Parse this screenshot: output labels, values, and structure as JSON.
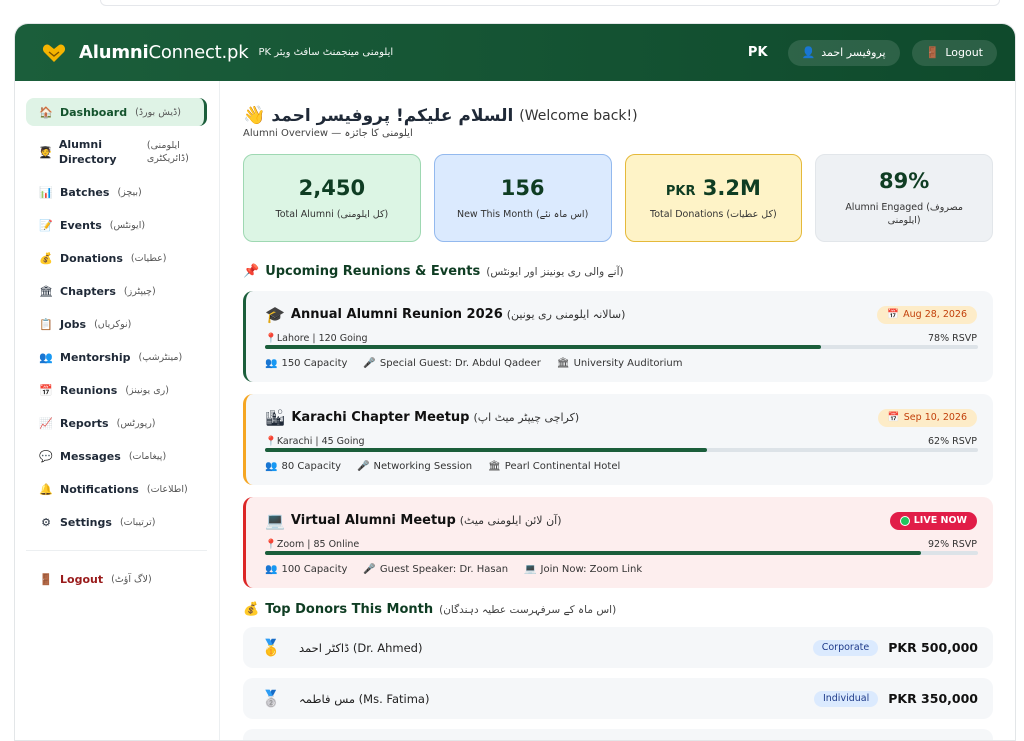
{
  "header": {
    "brand_bold": "Alumni",
    "brand_light": "Connect.pk",
    "subtitle": "PK ایلومنی مینجمنٹ سافٹ ویئر",
    "country": "PK",
    "user_label": "پروفیسر احمد",
    "logout_label": "Logout"
  },
  "sidebar": {
    "items": [
      {
        "label": "Dashboard",
        "urdu": "(ڈیش بورڈ)",
        "icon": "🏠"
      },
      {
        "label": "Alumni Directory",
        "urdu": "(ایلومنی ڈائریکٹری)",
        "icon": "🧑‍🎓"
      },
      {
        "label": "Batches",
        "urdu": "(بیچز)",
        "icon": "📊"
      },
      {
        "label": "Events",
        "urdu": "(ایونٹس)",
        "icon": "📝"
      },
      {
        "label": "Donations",
        "urdu": "(عطیات)",
        "icon": "💰"
      },
      {
        "label": "Chapters",
        "urdu": "(چیپٹرز)",
        "icon": "🏛"
      },
      {
        "label": "Jobs",
        "urdu": "(نوکریاں)",
        "icon": "📋"
      },
      {
        "label": "Mentorship",
        "urdu": "(مینٹرشپ)",
        "icon": "👥"
      },
      {
        "label": "Reunions",
        "urdu": "(ری یونینز)",
        "icon": "📅"
      },
      {
        "label": "Reports",
        "urdu": "(رپورٹس)",
        "icon": "📈"
      },
      {
        "label": "Messages",
        "urdu": "(پیغامات)",
        "icon": "💬"
      },
      {
        "label": "Notifications",
        "urdu": "(اطلاعات)",
        "icon": "🔔"
      },
      {
        "label": "Settings",
        "urdu": "(ترتیبات)",
        "icon": "⚙"
      }
    ],
    "logout": {
      "label": "Logout",
      "urdu": "(لاگ آؤٹ)",
      "icon": "🚪"
    }
  },
  "welcome": {
    "urdu": "السلام علیکم! پروفیسر احمد",
    "english": "(Welcome back!)",
    "overview": "Alumni Overview — ایلومنی کا جائزہ"
  },
  "stats": [
    {
      "value": "2,450",
      "label": "Total Alumni (کل ایلومنی)"
    },
    {
      "value": "156",
      "label": "New This Month (اس ماہ نئے)"
    },
    {
      "currency": "PKR",
      "value": "3.2M",
      "label": "Total Donations (کل عطیات)"
    },
    {
      "value": "89%",
      "label": "Alumni Engaged (مصروف ایلومنی)"
    }
  ],
  "events_section": {
    "title": "Upcoming Reunions & Events",
    "urdu": "(آنے والی ری یونینز اور ایونٹس)"
  },
  "events": [
    {
      "icon": "🎓",
      "title": "Annual Alumni Reunion 2026",
      "urdu": "(سالانہ ایلومنی ری یونین)",
      "date": "Aug 28, 2026",
      "location": "Lahore | 120 Going",
      "rsvp": "78% RSVP",
      "rsvp_fraction": 0.78,
      "capacity": "150 Capacity",
      "detail": "Special Guest: Dr. Abdul Qadeer",
      "venue": "University Auditorium"
    },
    {
      "icon": "🏙",
      "title": "Karachi Chapter Meetup",
      "urdu": "(کراچی چیپٹر میٹ اپ)",
      "date": "Sep 10, 2026",
      "location": "Karachi | 45 Going",
      "rsvp": "62% RSVP",
      "rsvp_fraction": 0.62,
      "capacity": "80 Capacity",
      "detail": "Networking Session",
      "venue": "Pearl Continental Hotel"
    },
    {
      "icon": "💻",
      "title": "Virtual Alumni Meetup",
      "urdu": "(آن لائن ایلومنی میٹ)",
      "live": "LIVE NOW",
      "location": "Zoom | 85 Online",
      "rsvp": "92% RSVP",
      "rsvp_fraction": 0.92,
      "capacity": "100 Capacity",
      "detail": "Guest Speaker: Dr. Hasan",
      "venue": "Join Now: Zoom Link"
    }
  ],
  "donors_section": {
    "title": "Top Donors This Month",
    "urdu": "(اس ماہ کے سرفہرست عطیہ دہندگان)"
  },
  "donors": [
    {
      "medal": "🥇",
      "name": "ڈاکٹر احمد (Dr. Ahmed)",
      "type": "Corporate",
      "amount": "PKR 500,000"
    },
    {
      "medal": "🥈",
      "name": "مس فاطمہ (Ms. Fatima)",
      "type": "Individual",
      "amount": "PKR 350,000"
    }
  ]
}
